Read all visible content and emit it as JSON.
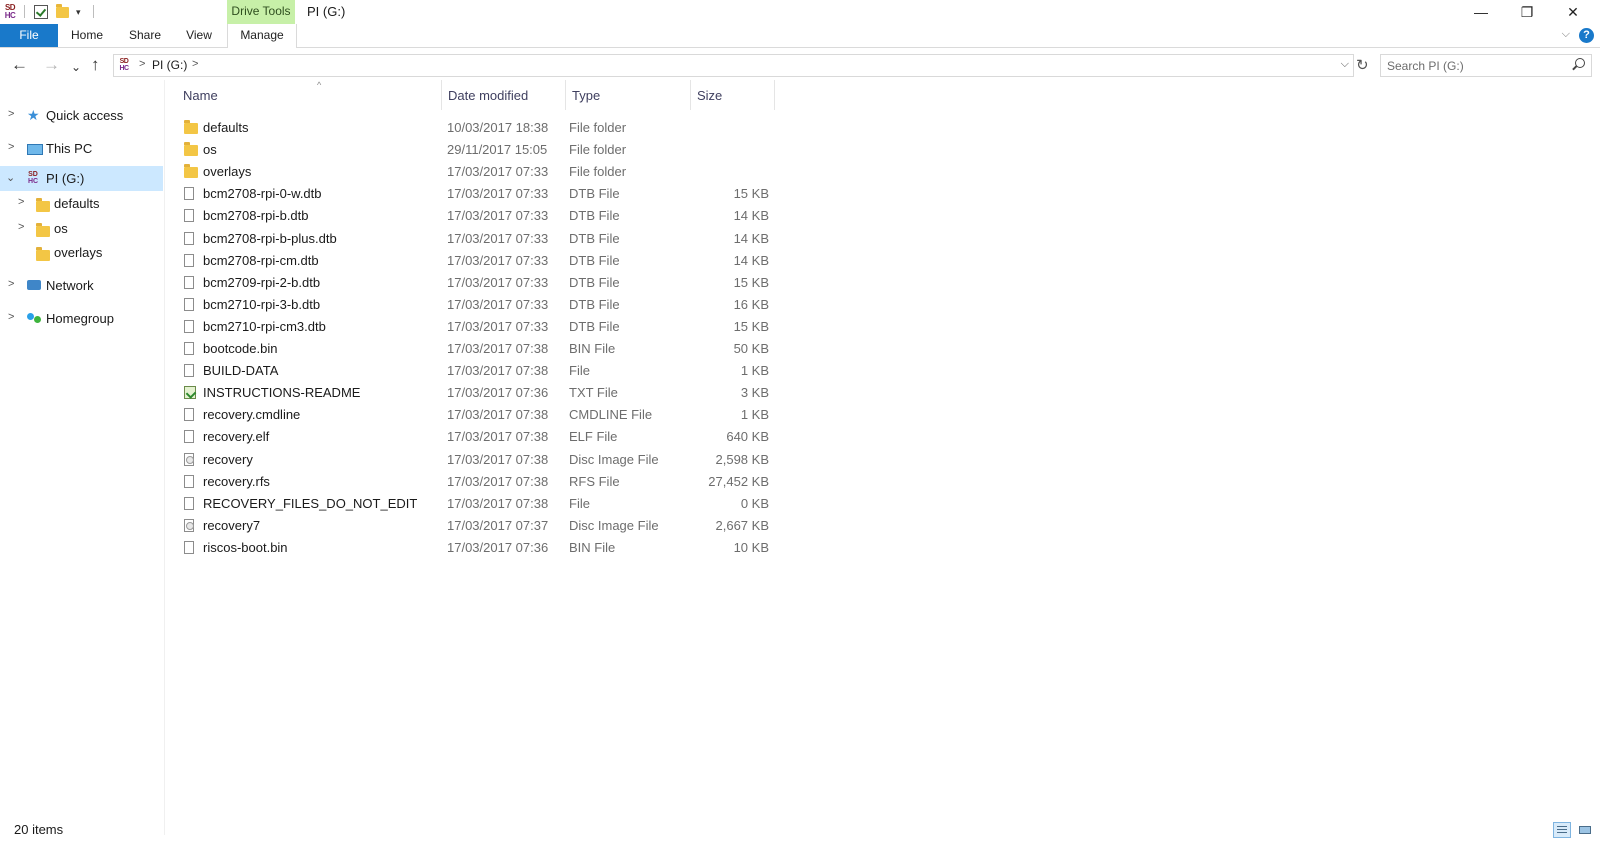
{
  "window": {
    "title": "PI (G:)",
    "contextual_tab": "Drive Tools",
    "minimize_glyph": "—",
    "maximize_glyph": "❐",
    "close_glyph": "✕"
  },
  "quick_access": {
    "drive_icon_line1": "SD",
    "drive_icon_line2": "HC",
    "dropdown_glyph": "▾"
  },
  "ribbon": {
    "file_tab": "File",
    "tabs": [
      "Home",
      "Share",
      "View",
      "Manage"
    ],
    "help_glyph": "?"
  },
  "address": {
    "path": "PI (G:)",
    "separator_glyph": ">",
    "dropdown_glyph": "⌵"
  },
  "nav_buttons": {
    "back": "←",
    "forward": "→",
    "recent": "⌄",
    "up": "↑",
    "refresh": "↻"
  },
  "search": {
    "placeholder": "Search PI (G:)"
  },
  "nav_pane": {
    "chevron_collapsed": ">",
    "chevron_expanded": "⌄",
    "items": [
      {
        "label": "Quick access"
      },
      {
        "label": "This PC"
      },
      {
        "label": "PI (G:)",
        "selected": true
      },
      {
        "label": "defaults"
      },
      {
        "label": "os"
      },
      {
        "label": "overlays"
      },
      {
        "label": "Network"
      },
      {
        "label": "Homegroup"
      }
    ]
  },
  "columns": {
    "name": "Name",
    "date": "Date modified",
    "type": "Type",
    "size": "Size",
    "sort_glyph": "^"
  },
  "files": [
    {
      "name": "defaults",
      "date": "10/03/2017 18:38",
      "type": "File folder",
      "size": "",
      "icon": "folder-icon"
    },
    {
      "name": "os",
      "date": "29/11/2017 15:05",
      "type": "File folder",
      "size": "",
      "icon": "folder-icon"
    },
    {
      "name": "overlays",
      "date": "17/03/2017 07:33",
      "type": "File folder",
      "size": "",
      "icon": "folder-icon"
    },
    {
      "name": "bcm2708-rpi-0-w.dtb",
      "date": "17/03/2017 07:33",
      "type": "DTB File",
      "size": "15 KB",
      "icon": "file-icon"
    },
    {
      "name": "bcm2708-rpi-b.dtb",
      "date": "17/03/2017 07:33",
      "type": "DTB File",
      "size": "14 KB",
      "icon": "file-icon"
    },
    {
      "name": "bcm2708-rpi-b-plus.dtb",
      "date": "17/03/2017 07:33",
      "type": "DTB File",
      "size": "14 KB",
      "icon": "file-icon"
    },
    {
      "name": "bcm2708-rpi-cm.dtb",
      "date": "17/03/2017 07:33",
      "type": "DTB File",
      "size": "14 KB",
      "icon": "file-icon"
    },
    {
      "name": "bcm2709-rpi-2-b.dtb",
      "date": "17/03/2017 07:33",
      "type": "DTB File",
      "size": "15 KB",
      "icon": "file-icon"
    },
    {
      "name": "bcm2710-rpi-3-b.dtb",
      "date": "17/03/2017 07:33",
      "type": "DTB File",
      "size": "16 KB",
      "icon": "file-icon"
    },
    {
      "name": "bcm2710-rpi-cm3.dtb",
      "date": "17/03/2017 07:33",
      "type": "DTB File",
      "size": "15 KB",
      "icon": "file-icon"
    },
    {
      "name": "bootcode.bin",
      "date": "17/03/2017 07:38",
      "type": "BIN File",
      "size": "50 KB",
      "icon": "file-icon"
    },
    {
      "name": "BUILD-DATA",
      "date": "17/03/2017 07:38",
      "type": "File",
      "size": "1 KB",
      "icon": "file-icon"
    },
    {
      "name": "INSTRUCTIONS-README",
      "date": "17/03/2017 07:36",
      "type": "TXT File",
      "size": "3 KB",
      "icon": "text-file-icon"
    },
    {
      "name": "recovery.cmdline",
      "date": "17/03/2017 07:38",
      "type": "CMDLINE File",
      "size": "1 KB",
      "icon": "file-icon"
    },
    {
      "name": "recovery.elf",
      "date": "17/03/2017 07:38",
      "type": "ELF File",
      "size": "640 KB",
      "icon": "file-icon"
    },
    {
      "name": "recovery",
      "date": "17/03/2017 07:38",
      "type": "Disc Image File",
      "size": "2,598 KB",
      "icon": "disc-image-icon"
    },
    {
      "name": "recovery.rfs",
      "date": "17/03/2017 07:38",
      "type": "RFS File",
      "size": "27,452 KB",
      "icon": "file-icon"
    },
    {
      "name": "RECOVERY_FILES_DO_NOT_EDIT",
      "date": "17/03/2017 07:38",
      "type": "File",
      "size": "0 KB",
      "icon": "file-icon"
    },
    {
      "name": "recovery7",
      "date": "17/03/2017 07:37",
      "type": "Disc Image File",
      "size": "2,667 KB",
      "icon": "disc-image-icon"
    },
    {
      "name": "riscos-boot.bin",
      "date": "17/03/2017 07:36",
      "type": "BIN File",
      "size": "10 KB",
      "icon": "file-icon"
    }
  ],
  "status": {
    "item_count": "20 items"
  },
  "colors": {
    "file_tab": "#1979ca",
    "context_tab": "#c7f0a8",
    "selection": "#cce8ff"
  }
}
